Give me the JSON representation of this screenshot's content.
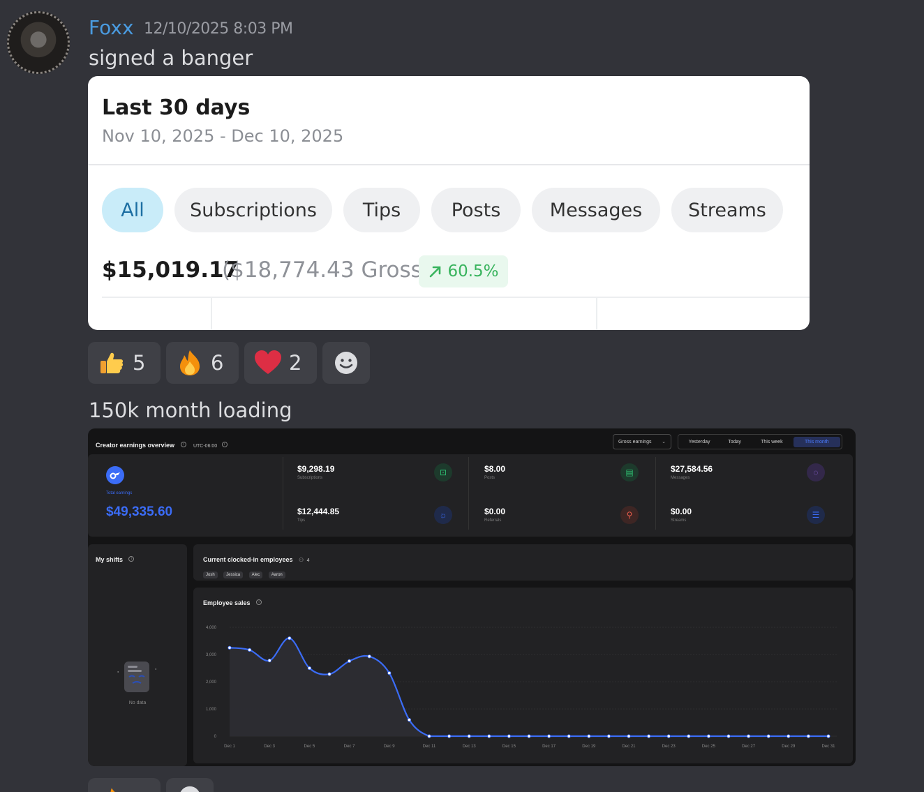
{
  "message1": {
    "username": "Foxx",
    "timestamp": "12/10/2025 8:03 PM",
    "text": "signed a banger"
  },
  "card1": {
    "title": "Last 30 days",
    "date_range": "Nov 10, 2025 - Dec 10, 2025",
    "filters": [
      "All",
      "Subscriptions",
      "Tips",
      "Posts",
      "Messages",
      "Streams"
    ],
    "active_filter": "All",
    "net_amount": "$15,019.17",
    "gross_amount": "($18,774.43 Gross)",
    "change_percent": "60.5%",
    "change_icon": "arrow-up-right-icon"
  },
  "reactions": [
    {
      "emoji": "thumbs-up-icon",
      "count": "5"
    },
    {
      "emoji": "fire-icon",
      "count": "6"
    },
    {
      "emoji": "heart-icon",
      "count": "2"
    }
  ],
  "message2": {
    "text": "150k month loading"
  },
  "dashboard": {
    "title": "Creator earnings overview",
    "timezone": "UTC-06:00",
    "earnings_select": "Gross earnings",
    "periods": [
      "Yesterday",
      "Today",
      "This week",
      "This month"
    ],
    "active_period": "This month",
    "accent": "#3b6cf6",
    "total_label": "Total earnings",
    "total_value": "$49,335.60",
    "stats": [
      {
        "value": "$9,298.19",
        "label": "Subscriptions",
        "icon": "subscriptions-icon",
        "color": "#2fbf71"
      },
      {
        "value": "$8.00",
        "label": "Posts",
        "icon": "posts-icon",
        "color": "#2fbf71"
      },
      {
        "value": "$27,584.56",
        "label": "Messages",
        "icon": "messages-icon",
        "color": "#9b6cf0"
      },
      {
        "value": "$12,444.85",
        "label": "Tips",
        "icon": "tips-icon",
        "color": "#3b6cf6"
      },
      {
        "value": "$0.00",
        "label": "Referrals",
        "icon": "referrals-icon",
        "color": "#e65b4b"
      },
      {
        "value": "$0.00",
        "label": "Streams",
        "icon": "streams-icon",
        "color": "#3b6cf6"
      }
    ],
    "shifts_title": "My shifts",
    "shifts_empty": "No data",
    "clocked_title": "Current clocked-in employees",
    "clocked_count": "4",
    "employees": [
      "Josh",
      "Jessica",
      "Alec",
      "Aaron"
    ],
    "sales_title": "Employee sales"
  },
  "chart_data": {
    "type": "area",
    "title": "Employee sales",
    "x": [
      "Dec 1",
      "Dec 2",
      "Dec 3",
      "Dec 4",
      "Dec 5",
      "Dec 6",
      "Dec 7",
      "Dec 8",
      "Dec 9",
      "Dec 10",
      "Dec 11",
      "Dec 12",
      "Dec 13",
      "Dec 14",
      "Dec 15",
      "Dec 16",
      "Dec 17",
      "Dec 18",
      "Dec 19",
      "Dec 20",
      "Dec 21",
      "Dec 22",
      "Dec 23",
      "Dec 24",
      "Dec 25",
      "Dec 26",
      "Dec 27",
      "Dec 28",
      "Dec 29",
      "Dec 30",
      "Dec 31"
    ],
    "x_tick_labels": [
      "Dec 1",
      "Dec 3",
      "Dec 5",
      "Dec 7",
      "Dec 9",
      "Dec 11",
      "Dec 13",
      "Dec 15",
      "Dec 17",
      "Dec 19",
      "Dec 21",
      "Dec 23",
      "Dec 25",
      "Dec 27",
      "Dec 29",
      "Dec 31"
    ],
    "y": [
      3250,
      3170,
      2780,
      3600,
      2500,
      2280,
      2760,
      2930,
      2320,
      600,
      0,
      0,
      0,
      0,
      0,
      0,
      0,
      0,
      0,
      0,
      0,
      0,
      0,
      0,
      0,
      0,
      0,
      0,
      0,
      0,
      0
    ],
    "y_ticks": [
      "0",
      "1,000",
      "2,000",
      "3,000",
      "4,000"
    ],
    "ylim": [
      0,
      4000
    ],
    "grid": true,
    "line_color": "#3b6cf6"
  }
}
